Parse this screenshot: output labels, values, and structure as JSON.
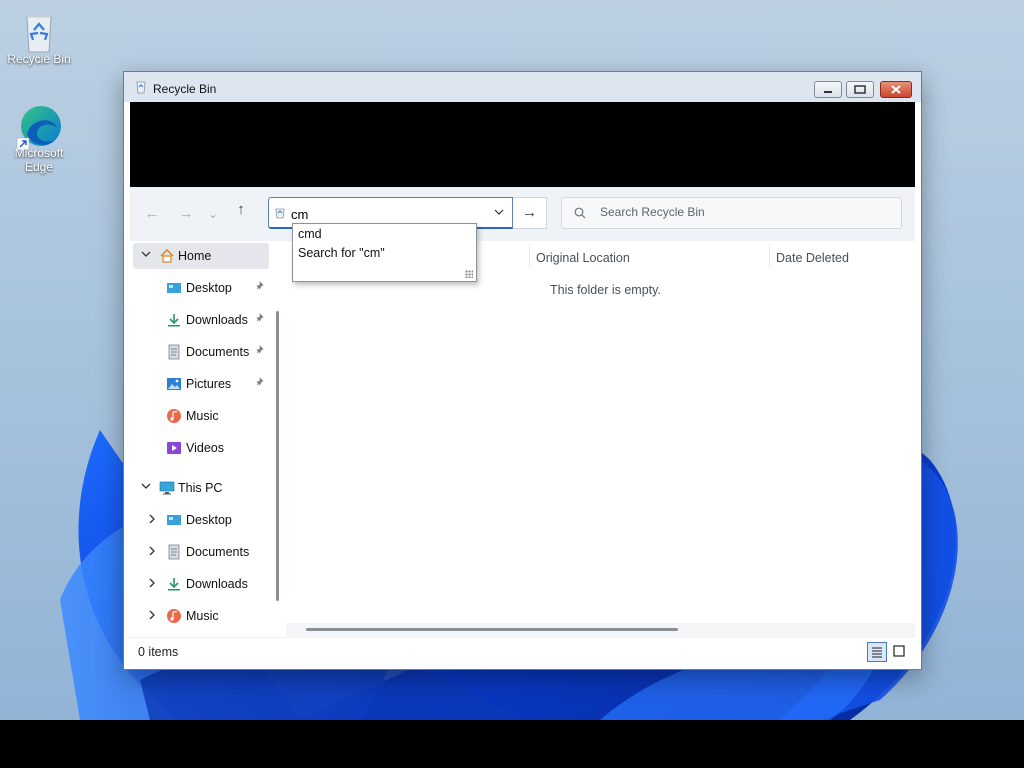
{
  "desktop": {
    "icons": [
      {
        "label": "Recycle Bin",
        "icon": "recycle-bin-icon"
      },
      {
        "label": "Microsoft Edge",
        "icon": "edge-icon"
      }
    ]
  },
  "window": {
    "title": "Recycle Bin",
    "title_icon": "recycle-bin-icon",
    "controls": [
      "minimize",
      "maximize",
      "close"
    ]
  },
  "navigation": {
    "back": "←",
    "forward": "→",
    "recent": "⌄",
    "up": "↑",
    "address_value": "cm",
    "go": "→"
  },
  "search": {
    "placeholder": "Search Recycle Bin"
  },
  "autocomplete": {
    "items": [
      "cmd",
      "Search for \"cm\""
    ]
  },
  "sidebar": {
    "items": [
      {
        "label": "Home",
        "icon": "home-icon",
        "expander": "⌄",
        "selected": true
      },
      {
        "label": "Desktop",
        "icon": "desktop-folder-icon",
        "pinned": true
      },
      {
        "label": "Downloads",
        "icon": "downloads-icon",
        "pinned": true
      },
      {
        "label": "Documents",
        "icon": "documents-icon",
        "pinned": true
      },
      {
        "label": "Pictures",
        "icon": "pictures-icon",
        "pinned": true
      },
      {
        "label": "Music",
        "icon": "music-icon"
      },
      {
        "label": "Videos",
        "icon": "videos-icon"
      },
      {
        "label": "This PC",
        "icon": "this-pc-icon",
        "expander": "⌄"
      },
      {
        "label": "Desktop",
        "icon": "desktop-folder-icon",
        "expander": "›"
      },
      {
        "label": "Documents",
        "icon": "documents-icon",
        "expander": "›"
      },
      {
        "label": "Downloads",
        "icon": "downloads-icon",
        "expander": "›"
      },
      {
        "label": "Music",
        "icon": "music-icon",
        "expander": "›"
      }
    ]
  },
  "content": {
    "columns": [
      "Original Location",
      "Date Deleted"
    ],
    "empty_message": "This folder is empty."
  },
  "status": {
    "items_count": "0 items"
  },
  "colors": {
    "accent": "#2b66c4",
    "selected_bg": "#e3e7ec",
    "titlebar": "#dde6f0"
  }
}
